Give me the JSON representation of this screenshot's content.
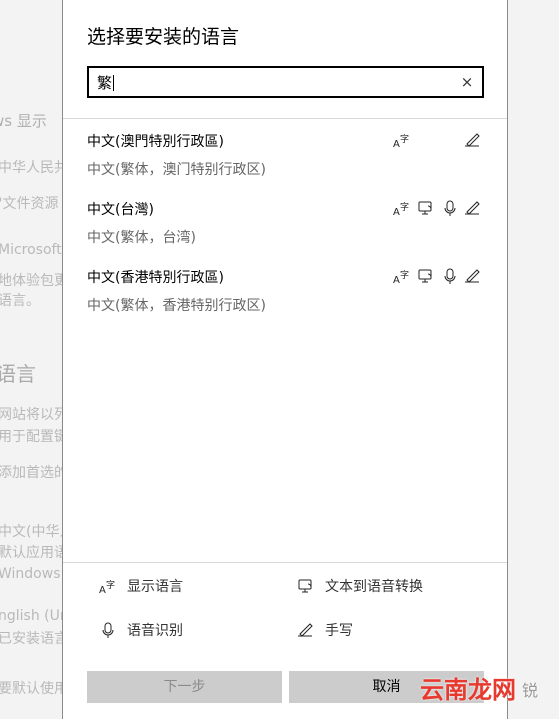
{
  "background": {
    "lines": [
      "ws 显示",
      "中华人民共",
      "\"文件资源",
      "Microsoft",
      "地体验包更",
      "语言。",
      "语言",
      "网站将以列",
      "用于配置键",
      "添加首选的",
      "中文(中华人",
      "默认应用语",
      "Windows 显",
      "nglish (Un",
      "已安装语言",
      "要默认使用"
    ]
  },
  "dialog": {
    "title": "选择要安装的语言",
    "search": {
      "value": "繁",
      "clear_icon": "×"
    },
    "languages": [
      {
        "name": "中文(澳門特別行政區)",
        "sub": "中文(繁体，澳门特别行政区)",
        "features": [
          "display-language",
          "handwriting"
        ]
      },
      {
        "name": "中文(台灣)",
        "sub": "中文(繁体，台湾)",
        "features": [
          "display-language",
          "text-to-speech",
          "speech-recognition",
          "handwriting"
        ]
      },
      {
        "name": "中文(香港特別行政區)",
        "sub": "中文(繁体，香港特别行政区)",
        "features": [
          "display-language",
          "text-to-speech",
          "speech-recognition",
          "handwriting"
        ]
      }
    ],
    "legend": {
      "display_language": "显示语言",
      "text_to_speech": "文本到语音转换",
      "speech_recognition": "语音识别",
      "handwriting": "手写"
    },
    "buttons": {
      "next": "下一步",
      "cancel": "取消"
    }
  },
  "watermark": {
    "text": "云南龙网",
    "tail": "锐"
  }
}
